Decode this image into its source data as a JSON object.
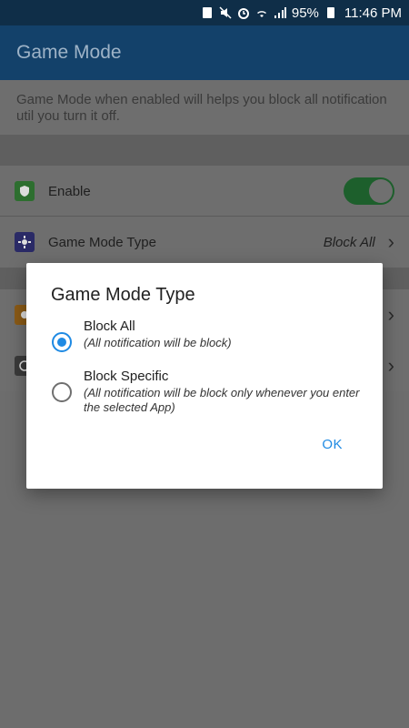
{
  "status_bar": {
    "icons": [
      "sim-icon",
      "mute-icon",
      "alarm-icon",
      "wifi-icon",
      "signal-icon"
    ],
    "battery": "95%",
    "time": "11:46 PM"
  },
  "app_bar": {
    "title": "Game Mode"
  },
  "description": "Game Mode when enabled will helps you block all notification util you turn it off.",
  "rows": {
    "enable": {
      "label": "Enable",
      "toggle_on": true,
      "icon": "shield-icon",
      "icon_color": "#2d6e2f"
    },
    "type": {
      "label": "Game Mode Type",
      "value": "Block All",
      "icon": "gear-icon",
      "icon_color": "#2a2a66"
    }
  },
  "dialog": {
    "title": "Game Mode Type",
    "options": [
      {
        "label": "Block All",
        "sub": "(All notification will be block)",
        "selected": true
      },
      {
        "label": "Block Specific",
        "sub": "(All notification will be block only whenever you enter the selected App)",
        "selected": false
      }
    ],
    "ok_label": "OK"
  },
  "colors": {
    "accent": "#1f8ae3",
    "toggle_on": "#4caf50",
    "app_bar": "#2f82c8"
  }
}
